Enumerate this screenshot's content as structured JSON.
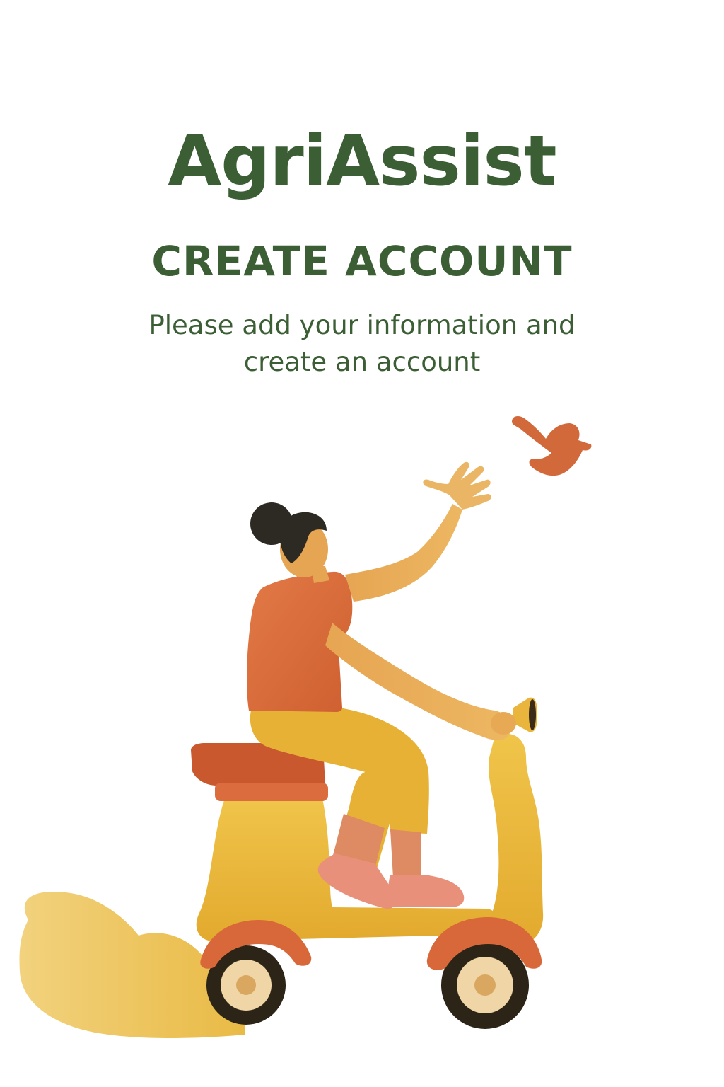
{
  "app": {
    "title": "AgriAssist"
  },
  "signup": {
    "heading": "CREATE ACCOUNT",
    "subtitle": "Please add your information and create an account"
  },
  "illustration": {
    "name": "woman-riding-scooter-illustration",
    "colors": {
      "scooter": "#eab83a",
      "accent": "#d96a3a",
      "pants": "#eab83a",
      "hair": "#2c2a22",
      "skin": "#e8aa50",
      "smoke": "#f0cd72",
      "text": "#3b5e34"
    }
  }
}
